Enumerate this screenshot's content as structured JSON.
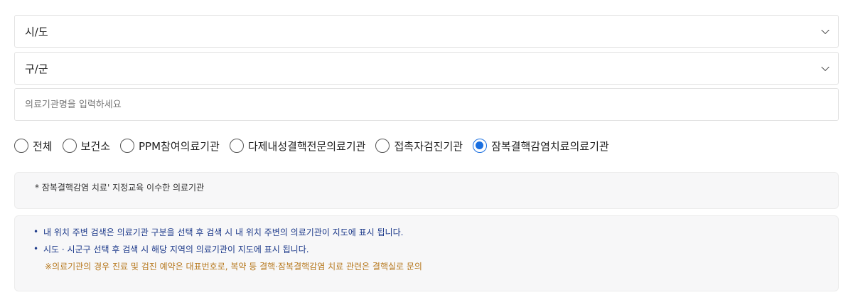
{
  "filters": {
    "sido_label": "시/도",
    "gugun_label": "구/군",
    "search_placeholder": "의료기관명을 입력하세요"
  },
  "radio_options": [
    {
      "label": "전체",
      "checked": false
    },
    {
      "label": "보건소",
      "checked": false
    },
    {
      "label": "PPM참여의료기관",
      "checked": false
    },
    {
      "label": "다제내성결핵전문의료기관",
      "checked": false
    },
    {
      "label": "접촉자검진기관",
      "checked": false
    },
    {
      "label": "잠복결핵감염치료의료기관",
      "checked": true
    }
  ],
  "note": {
    "text": "*  잠복결핵감염 치료' 지정교육 이수한 의료기관"
  },
  "info": {
    "bullet": "•",
    "line1": "내 위치 주변 검색은 의료기관 구분을 선택 후 검색 시 내 위치 주변의 의료기관이 지도에 표시 됩니다.",
    "line2": "시도 · 시군구 선택 후 검색 시 해당 지역의 의료기관이 지도에 표시 됩니다.",
    "warning": "※의료기관의 경우 진료 및 검진 예약은 대표번호로, 복약 등 결핵·잠복결핵감염 치료 관련은 결핵실로 문의"
  },
  "colors": {
    "accent": "#1a6fe0",
    "info_text": "#1d3a8a",
    "warning_text": "#b7791f"
  }
}
